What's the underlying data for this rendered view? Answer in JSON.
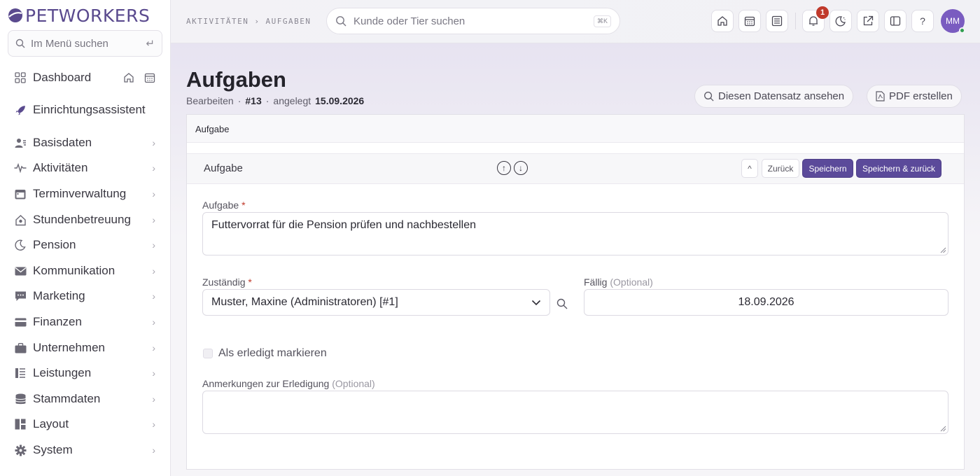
{
  "brand": {
    "name": "PETWORKERS"
  },
  "sidebar": {
    "search_placeholder": "Im Menü suchen",
    "items": [
      {
        "label": "Dashboard",
        "icon": "dashboard-icon"
      },
      {
        "label": "Einrichtungsassistent",
        "icon": "rocket-icon"
      },
      {
        "label": "Basisdaten",
        "icon": "users-icon"
      },
      {
        "label": "Aktivitäten",
        "icon": "activity-icon"
      },
      {
        "label": "Terminverwaltung",
        "icon": "calendar-icon"
      },
      {
        "label": "Stundenbetreuung",
        "icon": "house-icon"
      },
      {
        "label": "Pension",
        "icon": "moon-icon"
      },
      {
        "label": "Kommunikation",
        "icon": "mail-icon"
      },
      {
        "label": "Marketing",
        "icon": "chat-icon"
      },
      {
        "label": "Finanzen",
        "icon": "credit-card-icon"
      },
      {
        "label": "Unternehmen",
        "icon": "briefcase-icon"
      },
      {
        "label": "Leistungen",
        "icon": "list-icon"
      },
      {
        "label": "Stammdaten",
        "icon": "database-icon"
      },
      {
        "label": "Layout",
        "icon": "layout-icon"
      },
      {
        "label": "System",
        "icon": "gear-icon"
      }
    ]
  },
  "header": {
    "breadcrumb": [
      "AKTIVITÄTEN",
      "›",
      "AUFGABEN"
    ],
    "search_placeholder": "Kunde oder Tier suchen",
    "search_shortcut": "⌘K",
    "notification_count": "1",
    "help_label": "?",
    "avatar_initials": "MM"
  },
  "page": {
    "title": "Aufgaben",
    "mode": "Bearbeiten",
    "sep": "·",
    "record_id": "#13",
    "created_label": "angelegt",
    "created_date": "15.09.2026",
    "view_button": "Diesen Datensatz ansehen",
    "pdf_button": "PDF erstellen"
  },
  "form": {
    "tab_label": "Aufgabe",
    "section_title": "Aufgabe",
    "collapse_label": "^",
    "back_button": "Zurück",
    "save_button": "Speichern",
    "save_back_button": "Speichern & zurück",
    "task_label": "Aufgabe",
    "task_value": "Futtervorrat für die Pension prüfen und nachbestellen",
    "required_mark": "*",
    "assignee_label": "Zuständig",
    "assignee_value": "Muster, Maxine (Administratoren) [#1]",
    "due_label": "Fällig",
    "optional_label": "(Optional)",
    "due_value": "18.09.2026",
    "done_label": "Als erledigt markieren",
    "done_checked": false,
    "notes_label": "Anmerkungen zur Erledigung",
    "notes_value": ""
  },
  "colors": {
    "accent": "#5b4a9a",
    "badge": "#c0392b",
    "avatar": "#7a5cc0"
  }
}
